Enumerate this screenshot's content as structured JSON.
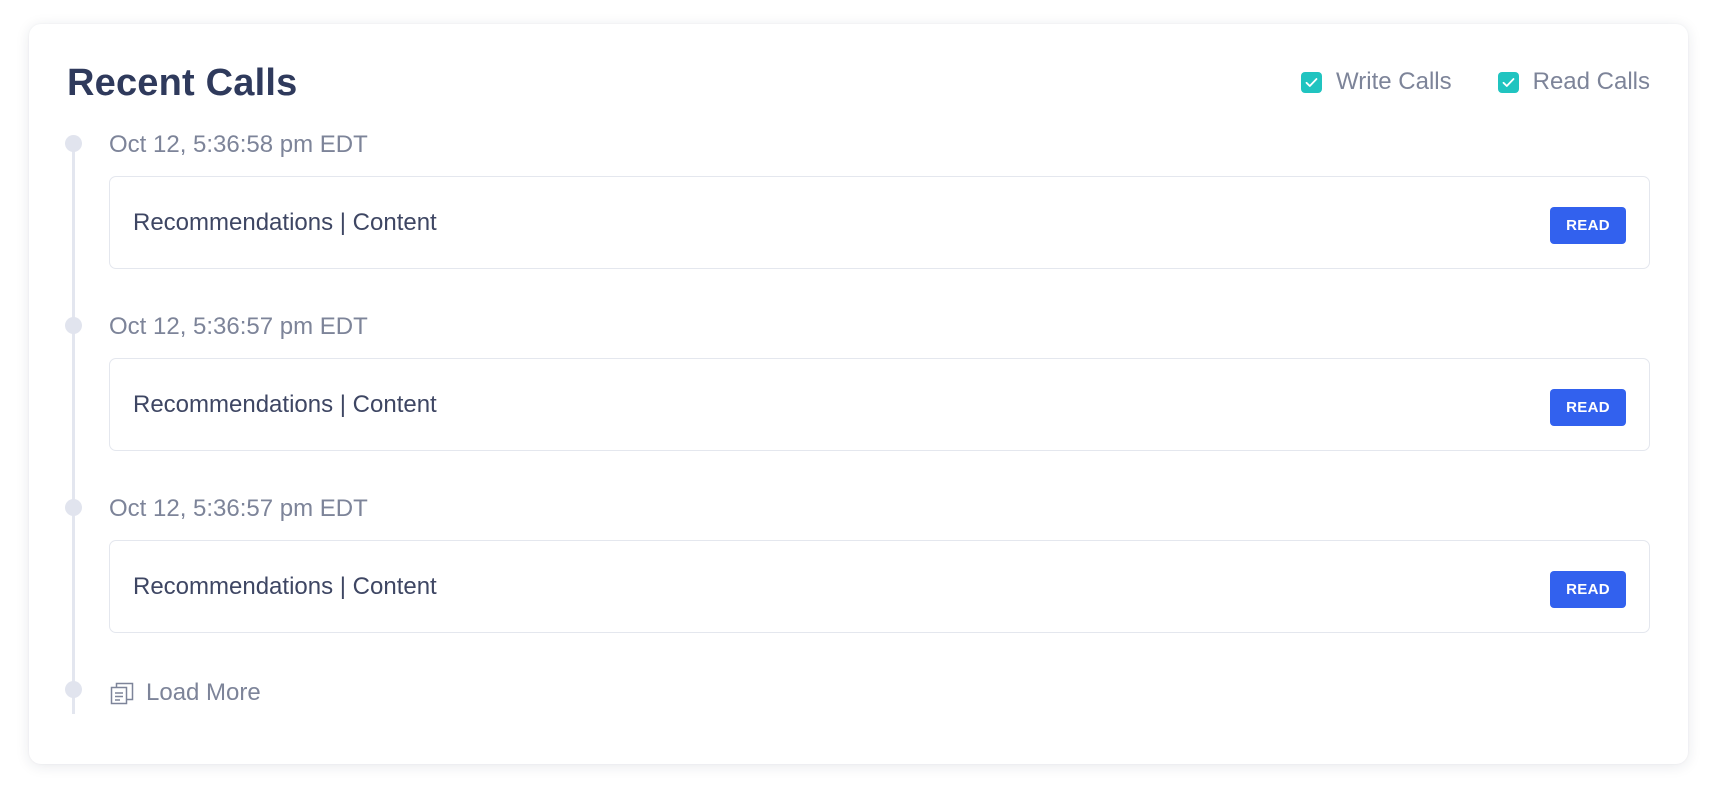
{
  "panel": {
    "title": "Recent Calls"
  },
  "filters": [
    {
      "label": "Write Calls",
      "checked": true,
      "icon": "checkmark-icon"
    },
    {
      "label": "Read Calls",
      "checked": true,
      "icon": "checkmark-icon"
    }
  ],
  "colors": {
    "accent_checkbox": "#20c4c0",
    "badge_read": "#3261ee",
    "title": "#2f3a5c"
  },
  "calls": [
    {
      "timestamp": "Oct 12, 5:36:58 pm EDT",
      "label": "Recommendations | Content",
      "badge": "READ"
    },
    {
      "timestamp": "Oct 12, 5:36:57 pm EDT",
      "label": "Recommendations | Content",
      "badge": "READ"
    },
    {
      "timestamp": "Oct 12, 5:36:57 pm EDT",
      "label": "Recommendations | Content",
      "badge": "READ"
    }
  ],
  "load_more": {
    "label": "Load More",
    "icon": "document-stack-icon"
  }
}
